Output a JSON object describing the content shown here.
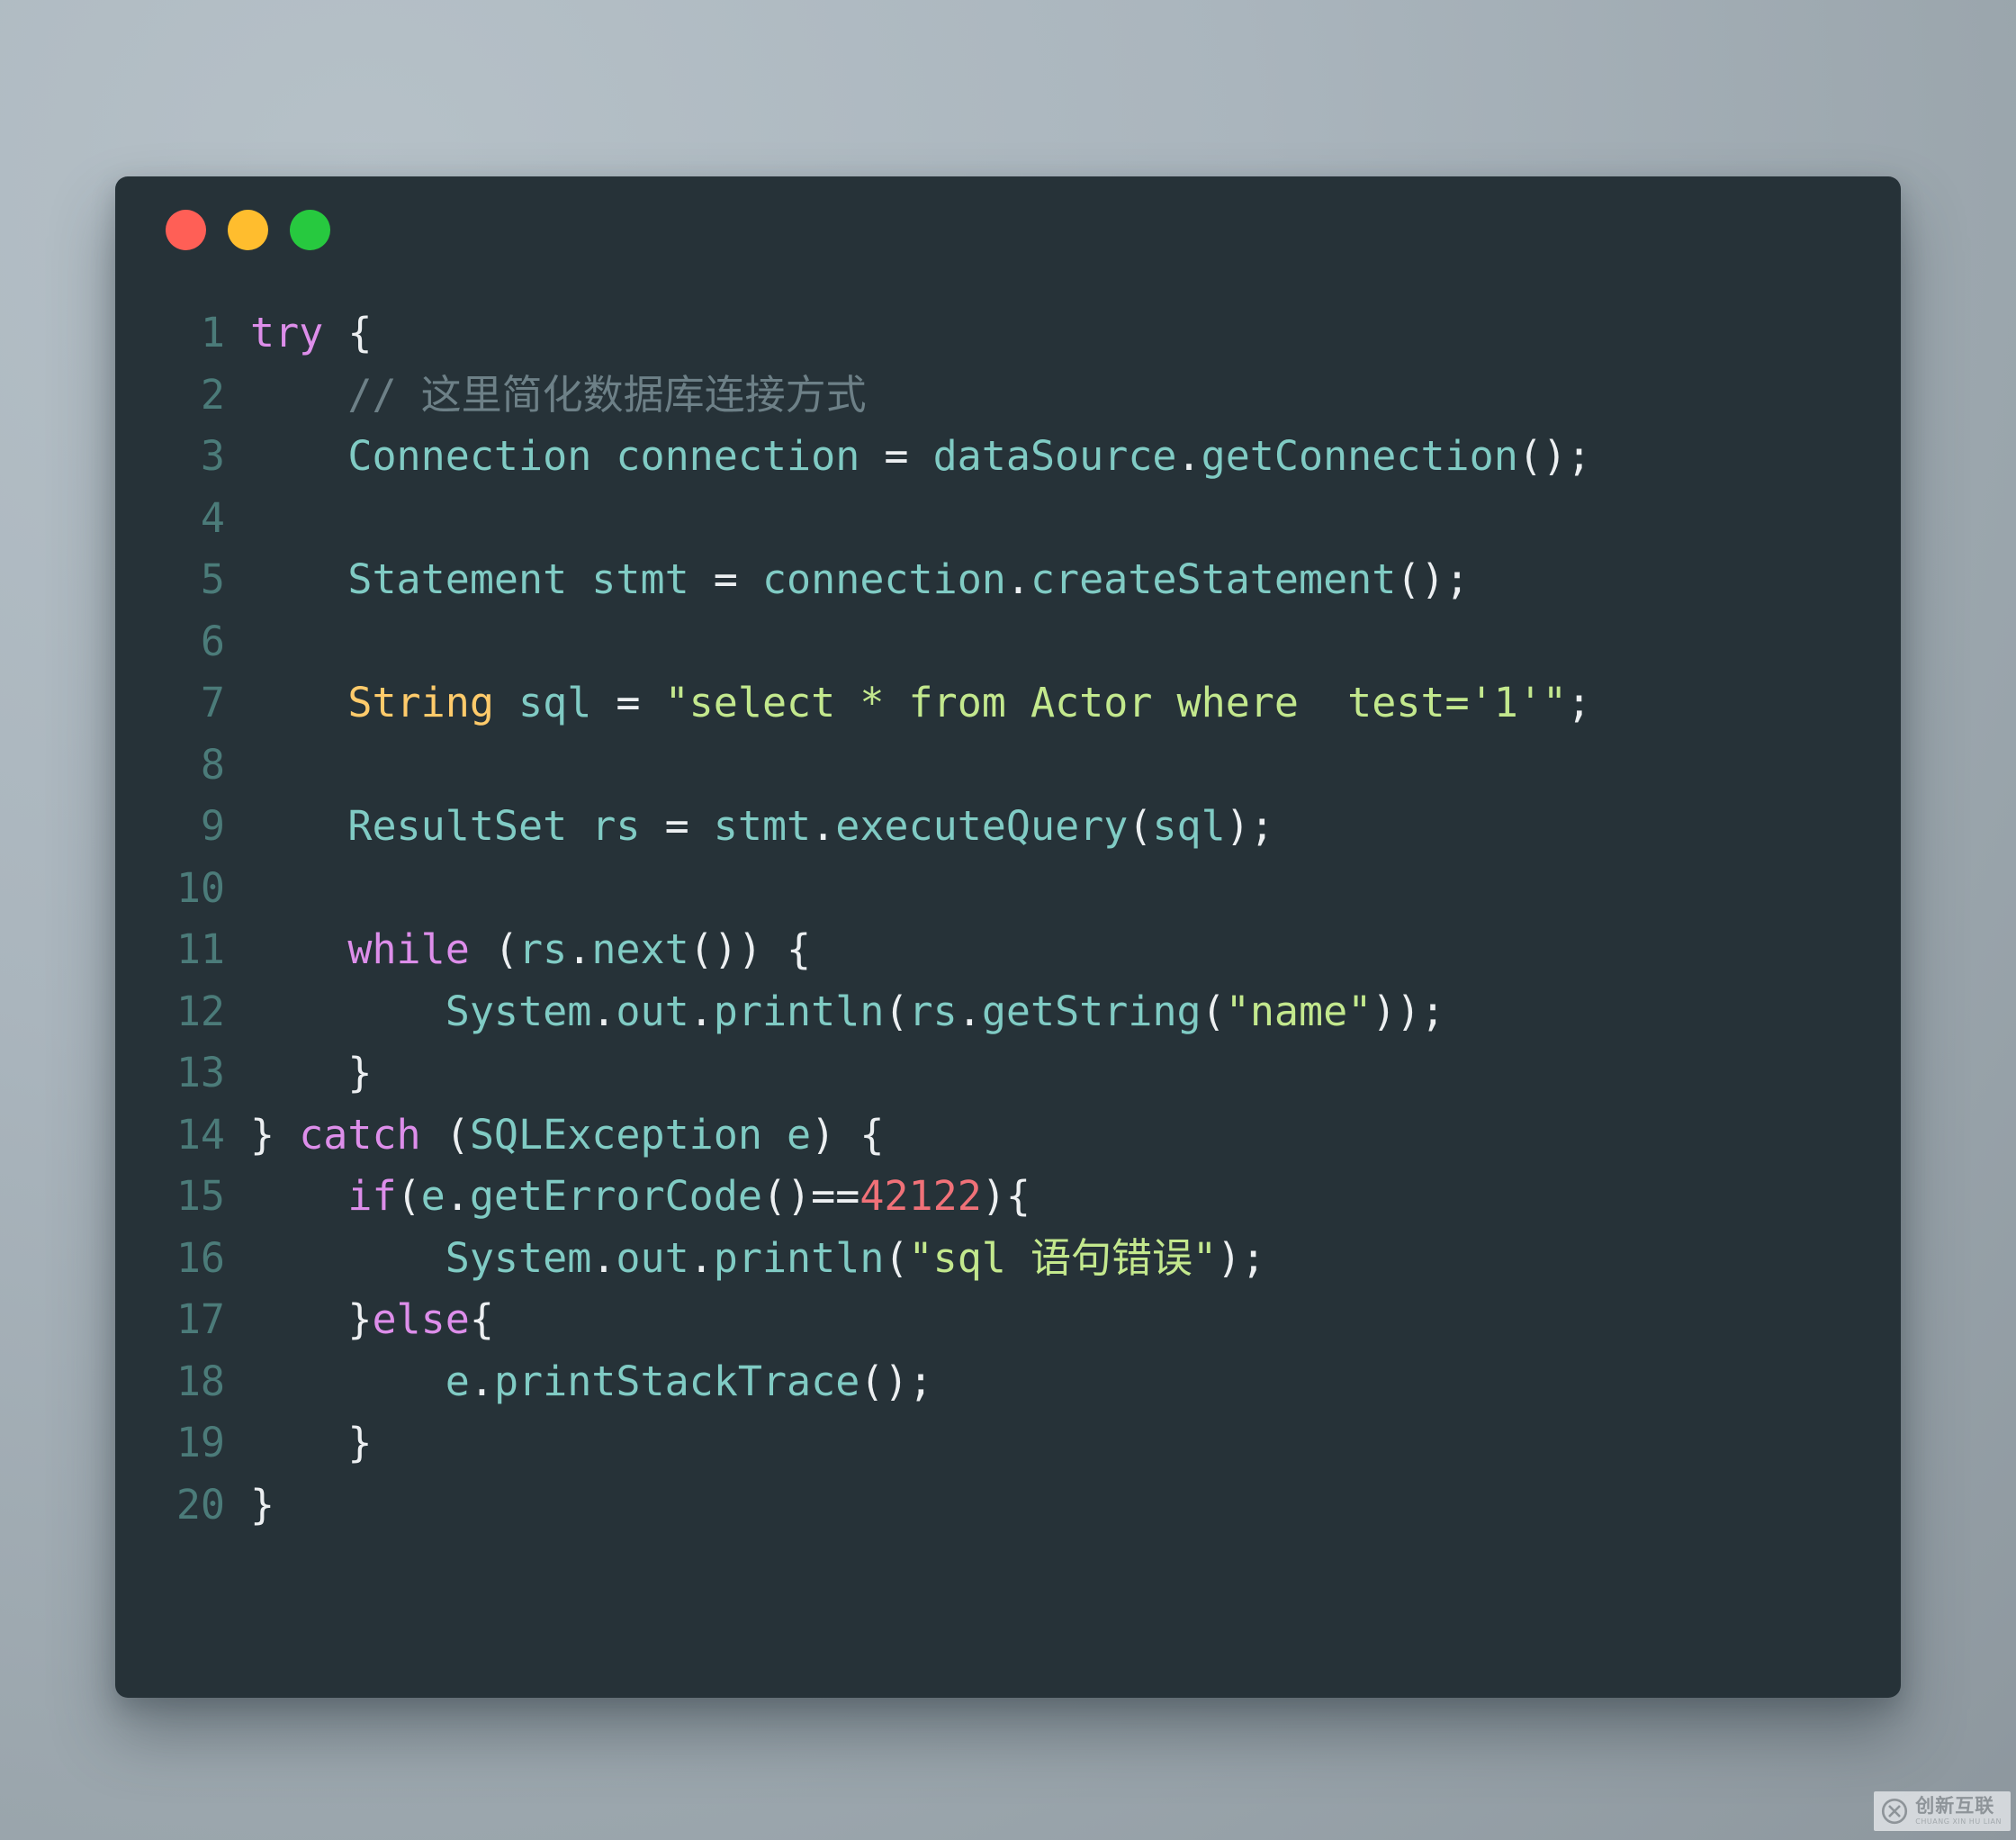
{
  "window": {
    "name": "code-snippet-window",
    "background_color": "#263238",
    "traffic_lights": [
      {
        "name": "close",
        "color": "#ff5f56"
      },
      {
        "name": "minimize",
        "color": "#ffbd2e"
      },
      {
        "name": "maximize",
        "color": "#27c93f"
      }
    ]
  },
  "page": {
    "background_color": "#adb8c0"
  },
  "editor": {
    "language": "java",
    "total_lines": 20,
    "gutter_color": "#4e7f7d",
    "lines": [
      {
        "number": "1",
        "text": "try {",
        "tokens": [
          {
            "t": "try",
            "c": "t-kw"
          },
          {
            "t": " ",
            "c": "t-plain"
          },
          {
            "t": "{",
            "c": "t-punc"
          }
        ]
      },
      {
        "number": "2",
        "text": "    // 这里简化数据库连接方式",
        "tokens": [
          {
            "t": "    ",
            "c": "t-plain"
          },
          {
            "t": "// 这里简化数据库连接方式",
            "c": "t-comment"
          }
        ]
      },
      {
        "number": "3",
        "text": "    Connection connection = dataSource.getConnection();",
        "tokens": [
          {
            "t": "    ",
            "c": "t-plain"
          },
          {
            "t": "Connection connection ",
            "c": "t-type"
          },
          {
            "t": "=",
            "c": "t-op"
          },
          {
            "t": " dataSource",
            "c": "t-type"
          },
          {
            "t": ".",
            "c": "t-punc"
          },
          {
            "t": "getConnection",
            "c": "t-type"
          },
          {
            "t": "();",
            "c": "t-punc"
          }
        ]
      },
      {
        "number": "4",
        "text": "",
        "tokens": []
      },
      {
        "number": "5",
        "text": "    Statement stmt = connection.createStatement();",
        "tokens": [
          {
            "t": "    ",
            "c": "t-plain"
          },
          {
            "t": "Statement stmt ",
            "c": "t-type"
          },
          {
            "t": "=",
            "c": "t-op"
          },
          {
            "t": " connection",
            "c": "t-type"
          },
          {
            "t": ".",
            "c": "t-punc"
          },
          {
            "t": "createStatement",
            "c": "t-type"
          },
          {
            "t": "();",
            "c": "t-punc"
          }
        ]
      },
      {
        "number": "6",
        "text": "",
        "tokens": []
      },
      {
        "number": "7",
        "text": "    String sql = \"select * from Actor where  test='1'\";",
        "tokens": [
          {
            "t": "    ",
            "c": "t-plain"
          },
          {
            "t": "String",
            "c": "t-yellow"
          },
          {
            "t": " sql ",
            "c": "t-type"
          },
          {
            "t": "=",
            "c": "t-op"
          },
          {
            "t": " ",
            "c": "t-plain"
          },
          {
            "t": "\"select * from Actor where  test='1'\"",
            "c": "t-str"
          },
          {
            "t": ";",
            "c": "t-punc"
          }
        ]
      },
      {
        "number": "8",
        "text": "",
        "tokens": []
      },
      {
        "number": "9",
        "text": "    ResultSet rs = stmt.executeQuery(sql);",
        "tokens": [
          {
            "t": "    ",
            "c": "t-plain"
          },
          {
            "t": "ResultSet rs ",
            "c": "t-type"
          },
          {
            "t": "=",
            "c": "t-op"
          },
          {
            "t": " stmt",
            "c": "t-type"
          },
          {
            "t": ".",
            "c": "t-punc"
          },
          {
            "t": "executeQuery",
            "c": "t-type"
          },
          {
            "t": "(",
            "c": "t-punc"
          },
          {
            "t": "sql",
            "c": "t-type"
          },
          {
            "t": ");",
            "c": "t-punc"
          }
        ]
      },
      {
        "number": "10",
        "text": "",
        "tokens": []
      },
      {
        "number": "11",
        "text": "    while (rs.next()) {",
        "tokens": [
          {
            "t": "    ",
            "c": "t-plain"
          },
          {
            "t": "while",
            "c": "t-kw"
          },
          {
            "t": " ",
            "c": "t-plain"
          },
          {
            "t": "(",
            "c": "t-punc"
          },
          {
            "t": "rs",
            "c": "t-type"
          },
          {
            "t": ".",
            "c": "t-punc"
          },
          {
            "t": "next",
            "c": "t-type"
          },
          {
            "t": "()) {",
            "c": "t-punc"
          }
        ]
      },
      {
        "number": "12",
        "text": "        System.out.println(rs.getString(\"name\"));",
        "tokens": [
          {
            "t": "        ",
            "c": "t-plain"
          },
          {
            "t": "System",
            "c": "t-type"
          },
          {
            "t": ".",
            "c": "t-punc"
          },
          {
            "t": "out",
            "c": "t-type"
          },
          {
            "t": ".",
            "c": "t-punc"
          },
          {
            "t": "println",
            "c": "t-type"
          },
          {
            "t": "(",
            "c": "t-punc"
          },
          {
            "t": "rs",
            "c": "t-type"
          },
          {
            "t": ".",
            "c": "t-punc"
          },
          {
            "t": "getString",
            "c": "t-type"
          },
          {
            "t": "(",
            "c": "t-punc"
          },
          {
            "t": "\"name\"",
            "c": "t-str"
          },
          {
            "t": "));",
            "c": "t-punc"
          }
        ]
      },
      {
        "number": "13",
        "text": "    }",
        "tokens": [
          {
            "t": "    ",
            "c": "t-plain"
          },
          {
            "t": "}",
            "c": "t-punc"
          }
        ]
      },
      {
        "number": "14",
        "text": "} catch (SQLException e) {",
        "tokens": [
          {
            "t": "} ",
            "c": "t-punc"
          },
          {
            "t": "catch",
            "c": "t-kw"
          },
          {
            "t": " ",
            "c": "t-plain"
          },
          {
            "t": "(",
            "c": "t-punc"
          },
          {
            "t": "SQLException e",
            "c": "t-type"
          },
          {
            "t": ") {",
            "c": "t-punc"
          }
        ]
      },
      {
        "number": "15",
        "text": "    if(e.getErrorCode()==42122){",
        "tokens": [
          {
            "t": "    ",
            "c": "t-plain"
          },
          {
            "t": "if",
            "c": "t-kw"
          },
          {
            "t": "(",
            "c": "t-punc"
          },
          {
            "t": "e",
            "c": "t-type"
          },
          {
            "t": ".",
            "c": "t-punc"
          },
          {
            "t": "getErrorCode",
            "c": "t-type"
          },
          {
            "t": "()",
            "c": "t-punc"
          },
          {
            "t": "==",
            "c": "t-op"
          },
          {
            "t": "42122",
            "c": "t-num"
          },
          {
            "t": "){",
            "c": "t-punc"
          }
        ]
      },
      {
        "number": "16",
        "text": "        System.out.println(\"sql 语句错误\");",
        "tokens": [
          {
            "t": "        ",
            "c": "t-plain"
          },
          {
            "t": "System",
            "c": "t-type"
          },
          {
            "t": ".",
            "c": "t-punc"
          },
          {
            "t": "out",
            "c": "t-type"
          },
          {
            "t": ".",
            "c": "t-punc"
          },
          {
            "t": "println",
            "c": "t-type"
          },
          {
            "t": "(",
            "c": "t-punc"
          },
          {
            "t": "\"sql 语句错误\"",
            "c": "t-str"
          },
          {
            "t": ");",
            "c": "t-punc"
          }
        ]
      },
      {
        "number": "17",
        "text": "    }else{",
        "tokens": [
          {
            "t": "    ",
            "c": "t-plain"
          },
          {
            "t": "}",
            "c": "t-punc"
          },
          {
            "t": "else",
            "c": "t-kw"
          },
          {
            "t": "{",
            "c": "t-punc"
          }
        ]
      },
      {
        "number": "18",
        "text": "        e.printStackTrace();",
        "tokens": [
          {
            "t": "        ",
            "c": "t-plain"
          },
          {
            "t": "e",
            "c": "t-type"
          },
          {
            "t": ".",
            "c": "t-punc"
          },
          {
            "t": "printStackTrace",
            "c": "t-type"
          },
          {
            "t": "();",
            "c": "t-punc"
          }
        ]
      },
      {
        "number": "19",
        "text": "    }",
        "tokens": [
          {
            "t": "    ",
            "c": "t-plain"
          },
          {
            "t": "}",
            "c": "t-punc"
          }
        ]
      },
      {
        "number": "20",
        "text": "}",
        "tokens": [
          {
            "t": "}",
            "c": "t-punc"
          }
        ]
      }
    ]
  },
  "watermark": {
    "chinese": "创新互联",
    "pinyin": "CHUANG XIN HU LIAN",
    "logo_icon": "circle-x-logo-icon"
  }
}
